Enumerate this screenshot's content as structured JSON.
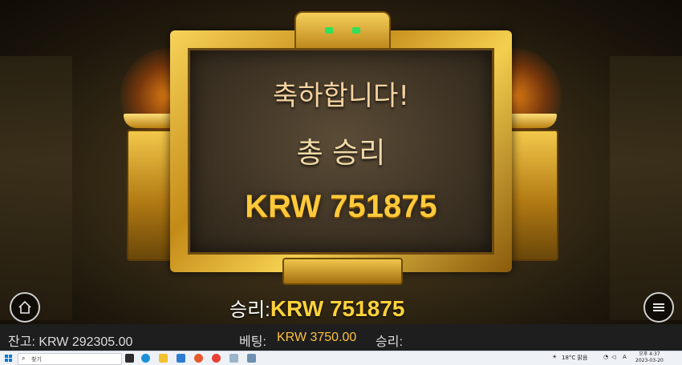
{
  "popup": {
    "congrats": "축하합니다!",
    "total_win_label": "총 승리",
    "total_win_amount": "KRW 751875"
  },
  "win_line": {
    "label": "승리:",
    "value": "KRW 751875"
  },
  "status_bar": {
    "balance": "잔고: KRW 292305.00",
    "bet_label": "베팅:",
    "bet_value": "KRW 3750.00",
    "win_label": "승리:"
  },
  "taskbar": {
    "search_placeholder": "찾기",
    "weather": "18°C 맑음",
    "ime": "A",
    "time": "오후 4:37",
    "date": "2023-03-20"
  },
  "colors": {
    "accent_gold": "#ffc93a",
    "status_bet_value": "#ffc23a"
  },
  "icons": {
    "home": "home-icon",
    "menu": "hamburger-menu-icon"
  }
}
